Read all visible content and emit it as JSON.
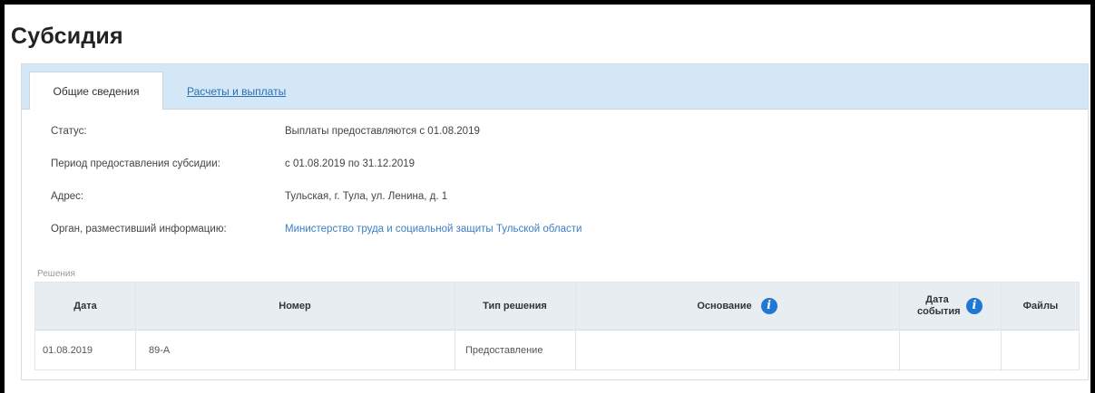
{
  "page": {
    "title": "Субсидия"
  },
  "tabs": [
    {
      "label": "Общие сведения",
      "active": true
    },
    {
      "label": "Расчеты и выплаты",
      "active": false
    }
  ],
  "info": {
    "status_label": "Статус:",
    "status_value": "Выплаты предоставляются с 01.08.2019",
    "period_label": "Период предоставления субсидии:",
    "period_value": "с 01.08.2019 по 31.12.2019",
    "address_label": "Адрес:",
    "address_value": "Тульская, г. Тула, ул. Ленина, д. 1",
    "org_label": "Орган, разместивший информацию:",
    "org_value": "Министерство труда и социальной защиты Тульской области"
  },
  "decisions": {
    "section_label": "Решения",
    "columns": [
      "Дата",
      "Номер",
      "Тип решения",
      "Основание",
      "Дата события",
      "Файлы"
    ],
    "rows": [
      {
        "date": "01.08.2019",
        "number": "89-А",
        "type": "Предоставление",
        "basis": "",
        "event_date": "",
        "files": ""
      }
    ]
  },
  "colors": {
    "tabbar": "#d4e7f6",
    "link": "#2a6fb5",
    "info_icon": "#1e78d4",
    "table_header": "#e8edf1"
  },
  "icons": {
    "basis_info": "info-icon",
    "event_date_info": "info-icon"
  }
}
